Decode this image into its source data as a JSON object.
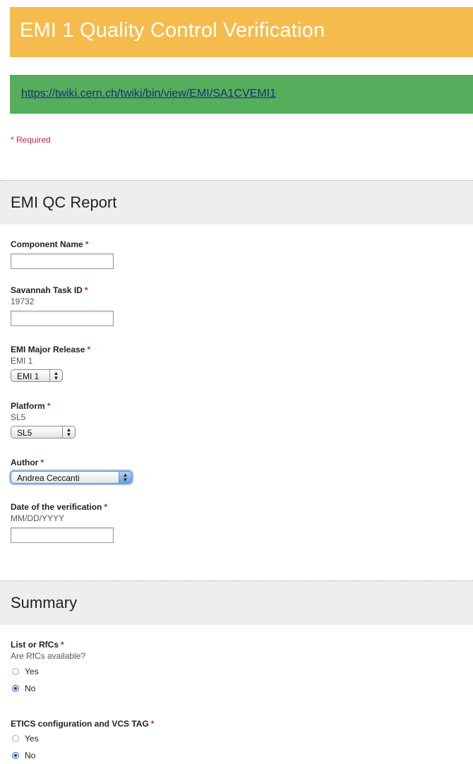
{
  "form": {
    "title": "EMI 1 Quality Control Verification",
    "link": "https://twiki.cern.ch/twiki/bin/view/EMI/SA1CVEMI1",
    "required_note": "* Required",
    "required_mark": "*"
  },
  "colors": {
    "title_bar": "#f6bb4d",
    "link_bar": "#55ae5c",
    "required": "#c4224b",
    "section_bg": "#eeeeee"
  },
  "sections": {
    "report": {
      "title": "EMI QC Report"
    },
    "summary": {
      "title": "Summary"
    }
  },
  "fields": {
    "component_name": {
      "label": "Component Name",
      "value": ""
    },
    "savannah_task_id": {
      "label": "Savannah Task ID",
      "help": "19732",
      "value": ""
    },
    "emi_major_release": {
      "label": "EMI Major Release",
      "help": "EMI 1",
      "selected": "EMI 1"
    },
    "platform": {
      "label": "Platform",
      "help": "SL5",
      "selected": "SL5"
    },
    "author": {
      "label": "Author",
      "selected": "Andrea Ceccanti"
    },
    "date": {
      "label": "Date of the verification",
      "help": "MM/DD/YYYY",
      "value": ""
    },
    "list_rfcs": {
      "label": "List or RfCs",
      "help": "Are RfCs available?",
      "options": [
        {
          "label": "Yes",
          "checked": false
        },
        {
          "label": "No",
          "checked": true
        }
      ]
    },
    "etics_config": {
      "label": "ETICS configuration and VCS TAG",
      "options": [
        {
          "label": "Yes",
          "checked": false
        },
        {
          "label": "No",
          "checked": true
        }
      ]
    }
  },
  "icons": {
    "select_arrows": "up-down-chevron-icon"
  }
}
